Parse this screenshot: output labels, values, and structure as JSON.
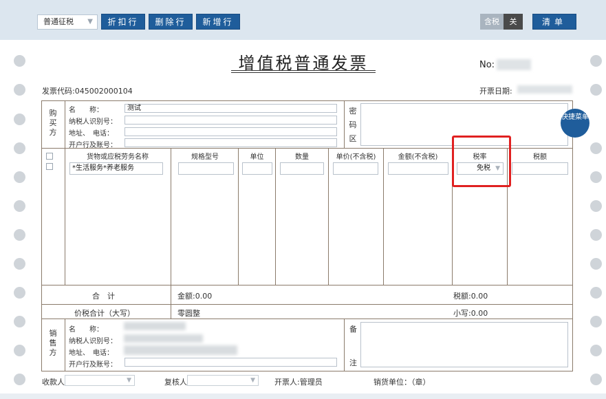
{
  "toolbar": {
    "invoice_type": "普通征税",
    "discount_label": "折扣行",
    "delete_label": "删除行",
    "add_label": "新增行",
    "tax_included_label": "含税",
    "tax_included_state": "关",
    "list_label": "清单"
  },
  "header": {
    "title": "增值税普通发票",
    "no_label": "No:",
    "invoice_code": "发票代码:045002000104",
    "issue_date_label": "开票日期:"
  },
  "buyer": {
    "section_label": "购买方",
    "name_label": "名　　称：",
    "name_value": "测试",
    "tax_id_label": "纳税人识别号：",
    "address_label": "地址、　电话：",
    "bank_label": "开户行及账号：",
    "cipher_label": "密码区"
  },
  "quick_menu": "快捷菜单",
  "items_table": {
    "columns": [
      "货物或应税劳务名称",
      "规格型号",
      "单位",
      "数量",
      "单价(不含税)",
      "金额(不含税)",
      "税率",
      "税额"
    ],
    "rows": [
      {
        "name": "*生活服务*养老服务",
        "spec": "",
        "unit": "",
        "qty": "",
        "price": "",
        "amount": "",
        "rate": "免税",
        "tax": ""
      }
    ]
  },
  "totals": {
    "total_label": "合　计",
    "amount_total": "金额:0.00",
    "tax_total": "税额:0.00",
    "grand_label": "价税合计（大写）",
    "grand_upper": "零圆整",
    "grand_lower": "小写:0.00"
  },
  "seller": {
    "section_label": "销售方",
    "name_label": "名　　称：",
    "tax_id_label": "纳税人识别号：",
    "address_label": "地址、　电话：",
    "bank_label": "开户行及账号：",
    "remark_label": "备注"
  },
  "footer": {
    "payee_label": "收款人:",
    "reviewer_label": "复核人:",
    "issuer": "开票人:管理员",
    "seller_seal": "销货单位：（章）"
  },
  "icons": {
    "dropdown": "chevron-down-icon"
  },
  "colors": {
    "button": "#1f5d9b",
    "highlight": "#e02020",
    "toolbar_bg": "#dce6ef"
  }
}
